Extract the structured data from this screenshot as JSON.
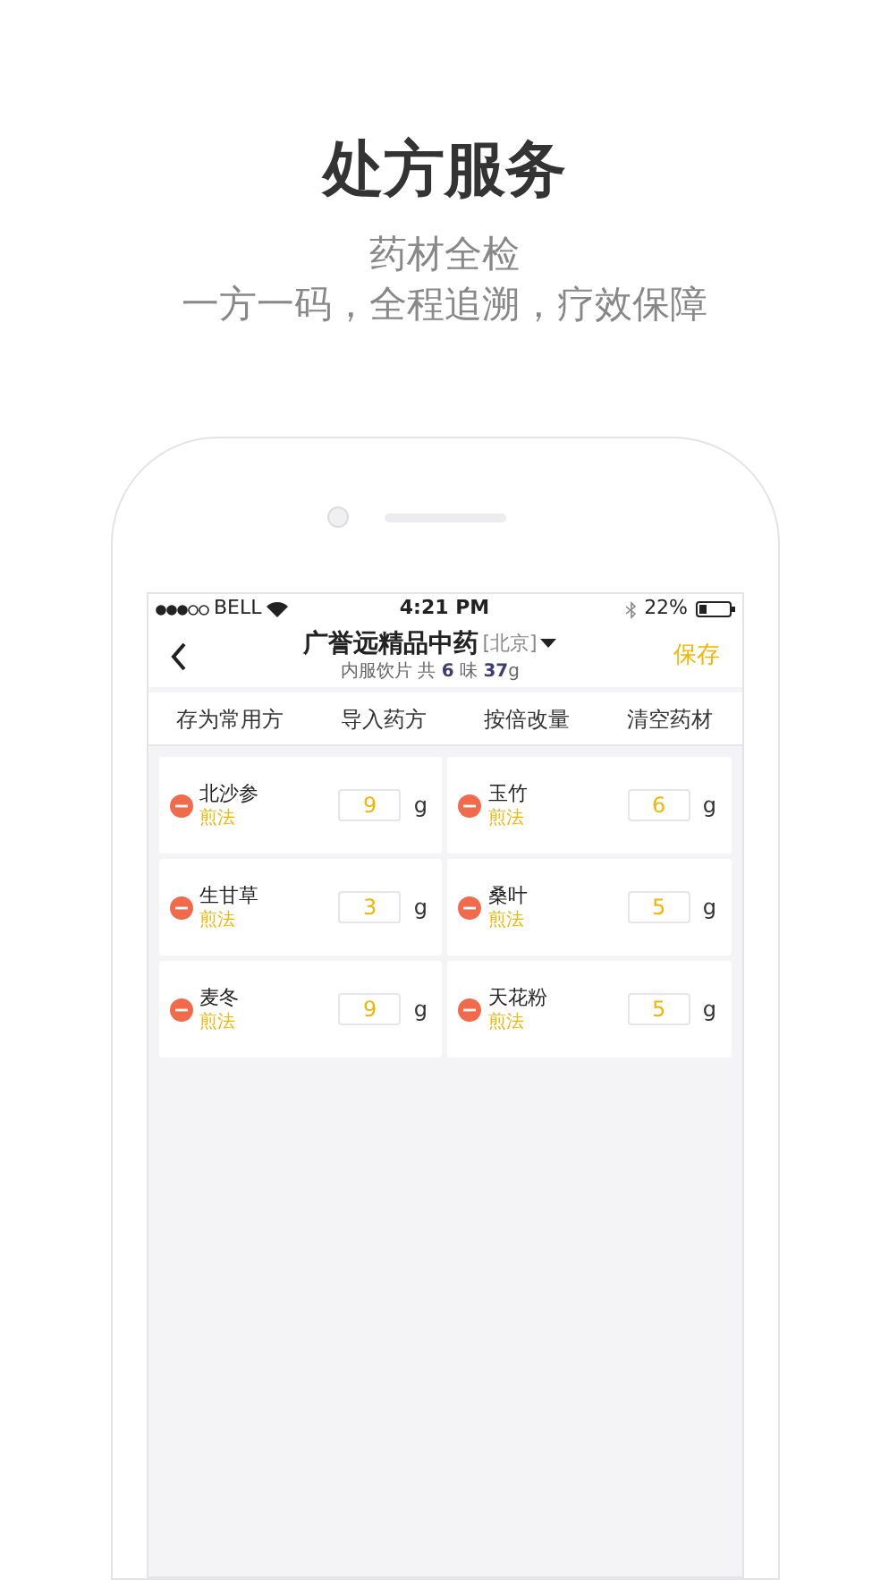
{
  "headline": {
    "title": "处方服务",
    "subtitle_lines": [
      "药材全检",
      "一方一码，全程追溯，疗效保障"
    ]
  },
  "status_bar": {
    "carrier": "BELL",
    "time": "4:21 PM",
    "battery": "22%"
  },
  "nav": {
    "title": "广誉远精品中药",
    "region": "[北京]",
    "summary": "内服饮片 共 **6** 味 **37**g",
    "save": "保存"
  },
  "toolbar": [
    "存为常用方",
    "导入药方",
    "按倍改量",
    "清空药材"
  ],
  "herbs": [
    {
      "name": "北沙参",
      "method": "煎法",
      "amount": "9",
      "unit": "g"
    },
    {
      "name": "玉竹",
      "method": "煎法",
      "amount": "6",
      "unit": "g"
    },
    {
      "name": "生甘草",
      "method": "煎法",
      "amount": "3",
      "unit": "g"
    },
    {
      "name": "桑叶",
      "method": "煎法",
      "amount": "5",
      "unit": "g"
    },
    {
      "name": "麦冬",
      "method": "煎法",
      "amount": "9",
      "unit": "g"
    },
    {
      "name": "天花粉",
      "method": "煎法",
      "amount": "5",
      "unit": "g"
    }
  ]
}
